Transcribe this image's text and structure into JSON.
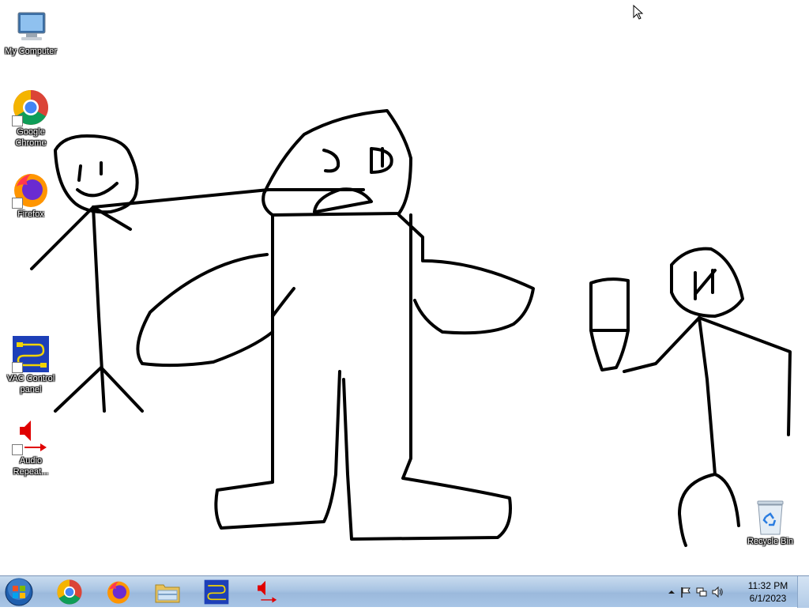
{
  "desktop": {
    "icons": [
      {
        "label": "My Computer",
        "icon": "computer-icon"
      },
      {
        "label": "Google Chrome",
        "icon": "chrome-icon"
      },
      {
        "label": "Firefox",
        "icon": "firefox-icon"
      },
      {
        "label": "VAC Control panel",
        "icon": "vac-icon"
      },
      {
        "label": "Audio Repeat...",
        "icon": "audio-repeater-icon"
      },
      {
        "label": "Recycle Bin",
        "icon": "recycle-bin-icon"
      }
    ]
  },
  "taskbar": {
    "pinned": [
      "start-orb",
      "chrome-icon",
      "firefox-icon",
      "explorer-icon",
      "vac-icon",
      "audio-repeater-icon"
    ],
    "clock": {
      "time": "11:32 PM",
      "date": "6/1/2023"
    }
  },
  "colors": {
    "taskbar": "#a9c4e3",
    "wallpaper": "#ffffff",
    "ink": "#000000"
  }
}
